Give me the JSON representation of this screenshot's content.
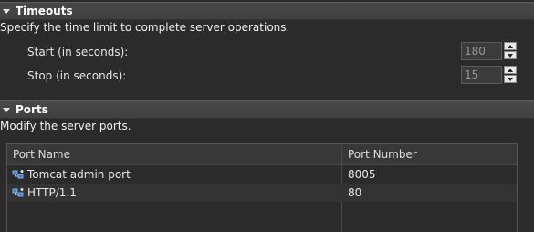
{
  "timeouts": {
    "title": "Timeouts",
    "description": "Specify the time limit to complete server operations.",
    "start_label": "Start (in seconds):",
    "start_value": "180",
    "stop_label": "Stop (in seconds):",
    "stop_value": "15"
  },
  "ports": {
    "title": "Ports",
    "description": "Modify the server ports.",
    "columns": [
      "Port Name",
      "Port Number"
    ],
    "rows": [
      {
        "name": "Tomcat admin port",
        "number": "8005",
        "icon": "port-icon"
      },
      {
        "name": "HTTP/1.1",
        "number": "80",
        "icon": "port-icon"
      }
    ]
  },
  "colors": {
    "background": "#2b2b2b",
    "header_bar": "#444444",
    "text": "#e6e6e6",
    "icon_blue": "#3d7fd6"
  }
}
